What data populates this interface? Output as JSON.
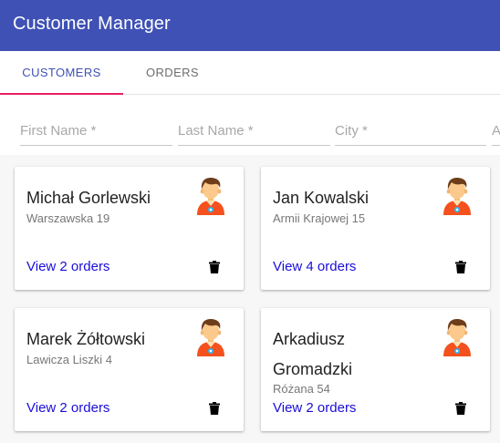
{
  "app": {
    "title": "Customer Manager"
  },
  "tabs": [
    {
      "label": "CUSTOMERS",
      "active": true
    },
    {
      "label": "ORDERS",
      "active": false
    }
  ],
  "filters": {
    "first_name": "First Name *",
    "last_name": "Last Name *",
    "city": "City *",
    "fourth": "A"
  },
  "customers": [
    {
      "name": "Michał Gorlewski",
      "address": "Warszawska 19",
      "orders_link": "View 2 orders"
    },
    {
      "name": "Jan Kowalski",
      "address": "Armii Krajowej 15",
      "orders_link": "View 4 orders"
    },
    {
      "name": "Marek Żółtowski",
      "address": "Lawicza Liszki 4",
      "orders_link": "View 2 orders"
    },
    {
      "name": "Arkadiusz Gromadzki",
      "address": "Różana 54",
      "orders_link": "View 2 orders"
    }
  ],
  "icons": {
    "avatar": "person-avatar-icon",
    "delete": "trash-icon"
  },
  "colors": {
    "primary": "#3f51b5",
    "accent": "#e91e63",
    "link": "#1a0dd8"
  }
}
